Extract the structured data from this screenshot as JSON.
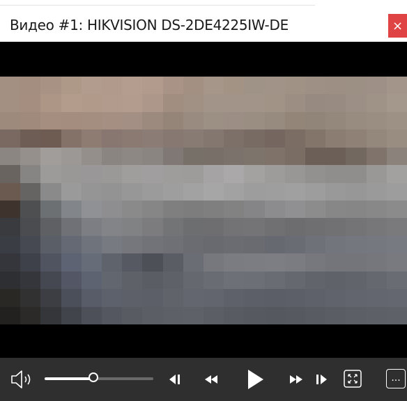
{
  "window": {
    "title": "Видео #1: HIKVISION DS-2DE4225IW-DE",
    "close_label": "×",
    "close_color": "#e04343"
  },
  "video": {
    "pixelation": {
      "rows": [
        [
          "#a49083",
          "#a48e80",
          "#a89283",
          "#ae9888",
          "#b29c8d",
          "#b19a8b",
          "#b49d8e",
          "#b29b8c",
          "#a89386",
          "#a39082",
          "#a6968a",
          "#a39385",
          "#9f9287",
          "#a19387",
          "#a19286",
          "#9f9085",
          "#9d8f84",
          "#9c8f84",
          "#9e9087",
          "#a39589"
        ],
        [
          "#a49082",
          "#a58e7f",
          "#ae9686",
          "#b49c8c",
          "#b29a8b",
          "#b29b8c",
          "#b39c8d",
          "#ad968a",
          "#a28e81",
          "#a19084",
          "#a29488",
          "#a39489",
          "#a29488",
          "#a19386",
          "#9c8e83",
          "#978a80",
          "#988b82",
          "#9c8f85",
          "#9f9287",
          "#a4978b"
        ],
        [
          "#9d8a7c",
          "#a08a7b",
          "#a58e7f",
          "#a48c7e",
          "#a38e80",
          "#a48f82",
          "#a38f83",
          "#9c8a7e",
          "#958578",
          "#998b7f",
          "#9c8f84",
          "#9c8e84",
          "#9a8d82",
          "#978a7f",
          "#938679",
          "#918479",
          "#94877c",
          "#988b80",
          "#9a8d82",
          "#9d9085"
        ],
        [
          "#7a6960",
          "#6e5d54",
          "#6e5c52",
          "#847168",
          "#8e7c73",
          "#887770",
          "#8a7a72",
          "#8b7c75",
          "#877971",
          "#887b73",
          "#847770",
          "#7d7068",
          "#776b63",
          "#75675f",
          "#7b6d64",
          "#837569",
          "#8b7d72",
          "#8f8176",
          "#94877c",
          "#998c81"
        ],
        [
          "#8c8682",
          "#96908d",
          "#a19d9a",
          "#9c9896",
          "#958f8b",
          "#8b8581",
          "#8d8884",
          "#8b8581",
          "#7f7874",
          "#777069",
          "#776f68",
          "#7b726b",
          "#7d746c",
          "#7e7269",
          "#7a6d63",
          "#6c5f57",
          "#6b5f58",
          "#736860",
          "#7f736c",
          "#8b827b"
        ],
        [
          "#6a6461",
          "#878584",
          "#9d9b9a",
          "#9a9897",
          "#999797",
          "#9b9998",
          "#a09e9d",
          "#a09e9e",
          "#9f9d9c",
          "#9e9c9b",
          "#a5a3a3",
          "#aaa8a8",
          "#a4a2a1",
          "#9e9c9b",
          "#999796",
          "#939190",
          "#908e8d",
          "#908e8d",
          "#9a9897",
          "#a3a1a0"
        ],
        [
          "#6b5a4f",
          "#656463",
          "#8a8a8a",
          "#9a9a9a",
          "#959595",
          "#939393",
          "#979797",
          "#9b9b9b",
          "#9e9e9e",
          "#a2a2a2",
          "#a6a6a6",
          "#a2a2a2",
          "#9d9d9d",
          "#9e9e9e",
          "#a0a0a0",
          "#9d9d9d",
          "#999999",
          "#979797",
          "#9a9a9a",
          "#9d9d9d"
        ],
        [
          "#3f342d",
          "#4e4f51",
          "#6d7073",
          "#82858a",
          "#8f9195",
          "#8e8e90",
          "#8a8a8b",
          "#868686",
          "#7f7f80",
          "#7d7d7e",
          "#7f7f80",
          "#828283",
          "#858587",
          "#8c8c8e",
          "#909092",
          "#8c8c8d",
          "#878788",
          "#868687",
          "#888889",
          "#8b8b8c"
        ],
        [
          "#3a3b3f",
          "#4b4c50",
          "#5e6064",
          "#6f7176",
          "#7c7e84",
          "#838488",
          "#818284",
          "#7c7c7e",
          "#737476",
          "#6d6e70",
          "#6e6e70",
          "#737375",
          "#747476",
          "#707072",
          "#6d6d6f",
          "#6f6f71",
          "#717173",
          "#747476",
          "#77777a",
          "#7a7a7c"
        ],
        [
          "#3b3d44",
          "#464952",
          "#5a5e67",
          "#656973",
          "#6f737c",
          "#777a80",
          "#75777c",
          "#717378",
          "#6e7075",
          "#6a6c71",
          "#686a6f",
          "#6a6c72",
          "#696b71",
          "#676970",
          "#6a6c73",
          "#6f7178",
          "#73757c",
          "#75777e",
          "#767880",
          "#787a81"
        ],
        [
          "#34363c",
          "#3e414a",
          "#4f5460",
          "#5d6372",
          "#666c78",
          "#5f636c",
          "#565961",
          "#4e5058",
          "#5a5d64",
          "#6a6d73",
          "#76787e",
          "#7a7c82",
          "#7b7d83",
          "#7c7e84",
          "#7a7c82",
          "#76787e",
          "#73757b",
          "#73757b",
          "#75777d",
          "#787a80"
        ],
        [
          "#2e2f33",
          "#35363b",
          "#454851",
          "#535765",
          "#5e6372",
          "#62666f",
          "#5f6169",
          "#5b5d64",
          "#5f6168",
          "#666870",
          "#6a6c74",
          "#6e7078",
          "#6d6f77",
          "#6a6c74",
          "#666870",
          "#62646c",
          "#60626a",
          "#62646c",
          "#666870",
          "#6a6c74"
        ],
        [
          "#2a2825",
          "#323131",
          "#3c3e44",
          "#4b4f59",
          "#575c68",
          "#5d616b",
          "#5d6068",
          "#5c5f67",
          "#60636a",
          "#63666e",
          "#62656d",
          "#5e6169",
          "#5c5f67",
          "#5b5e66",
          "#5c5f67",
          "#5e6169",
          "#60636b",
          "#62656d",
          "#63666e",
          "#64676f"
        ],
        [
          "#222120",
          "#2b2a29",
          "#353639",
          "#41444b",
          "#4d5059",
          "#54575f",
          "#585b62",
          "#5b5e65",
          "#5d6067",
          "#5e6168",
          "#5b5e65",
          "#585b62",
          "#565960",
          "#55585f",
          "#565960",
          "#585b62",
          "#5a5d64",
          "#5c5f66",
          "#5d6067",
          "#5e6168"
        ]
      ]
    }
  },
  "controls": {
    "volume_icon": "volume-icon",
    "volume_level": 0.45,
    "buttons": [
      {
        "name": "previous-frame-button",
        "icon": "step-back-icon"
      },
      {
        "name": "rewind-button",
        "icon": "rewind-icon"
      },
      {
        "name": "play-button",
        "icon": "play-icon"
      },
      {
        "name": "fast-forward-button",
        "icon": "fast-forward-icon"
      },
      {
        "name": "next-frame-button",
        "icon": "step-forward-icon"
      },
      {
        "name": "fullscreen-button",
        "icon": "fullscreen-icon"
      },
      {
        "name": "more-button",
        "icon": "ellipsis-icon"
      }
    ],
    "more_label": "...",
    "bar_color": "#2f2f2f"
  }
}
